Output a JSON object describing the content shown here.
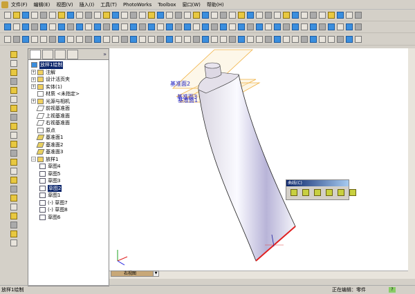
{
  "menu": [
    "文件(F)",
    "编辑(E)",
    "视图(V)",
    "插入(I)",
    "工具(T)",
    "PhotoWorks",
    "Toolbox",
    "窗口(W)",
    "帮助(H)"
  ],
  "feature_tree": {
    "root": "放样1绘制",
    "items": [
      {
        "label": "注解",
        "expand": true,
        "icon": "annotation"
      },
      {
        "label": "设计活页夹",
        "expand": true,
        "icon": "binder"
      },
      {
        "label": "实体(1)",
        "expand": true,
        "icon": "solid-body"
      },
      {
        "label": "材质 <未指定>",
        "expand": false,
        "icon": "material"
      },
      {
        "label": "光源与相机",
        "expand": true,
        "icon": "lights"
      },
      {
        "label": "前视基准面",
        "expand": false,
        "icon": "plane"
      },
      {
        "label": "上视基准面",
        "expand": false,
        "icon": "plane"
      },
      {
        "label": "右视基准面",
        "expand": false,
        "icon": "plane"
      },
      {
        "label": "原点",
        "expand": false,
        "icon": "origin"
      },
      {
        "label": "基准面1",
        "expand": false,
        "icon": "plane-y"
      },
      {
        "label": "基准面2",
        "expand": false,
        "icon": "plane-y"
      },
      {
        "label": "基准面3",
        "expand": false,
        "icon": "plane-y"
      },
      {
        "label": "放样1",
        "expand": true,
        "icon": "loft"
      }
    ],
    "sketches": [
      "草图4",
      "草图5",
      "草图3",
      "草图2",
      "草图1",
      "(-) 草图7",
      "(-) 草图8",
      "草图6"
    ],
    "selected_sketch": "草图2"
  },
  "viewport": {
    "plane_labels": [
      "基准面2",
      "基准面3",
      "基准面1"
    ],
    "accent_edge": "#e02020",
    "plane_color": "#f0b040"
  },
  "curves_toolbar": {
    "title": "曲线(C)"
  },
  "sheet_tab": "右视图",
  "status": {
    "left": "放样1绘制",
    "right": "正在编辑：零件",
    "help": "?"
  }
}
